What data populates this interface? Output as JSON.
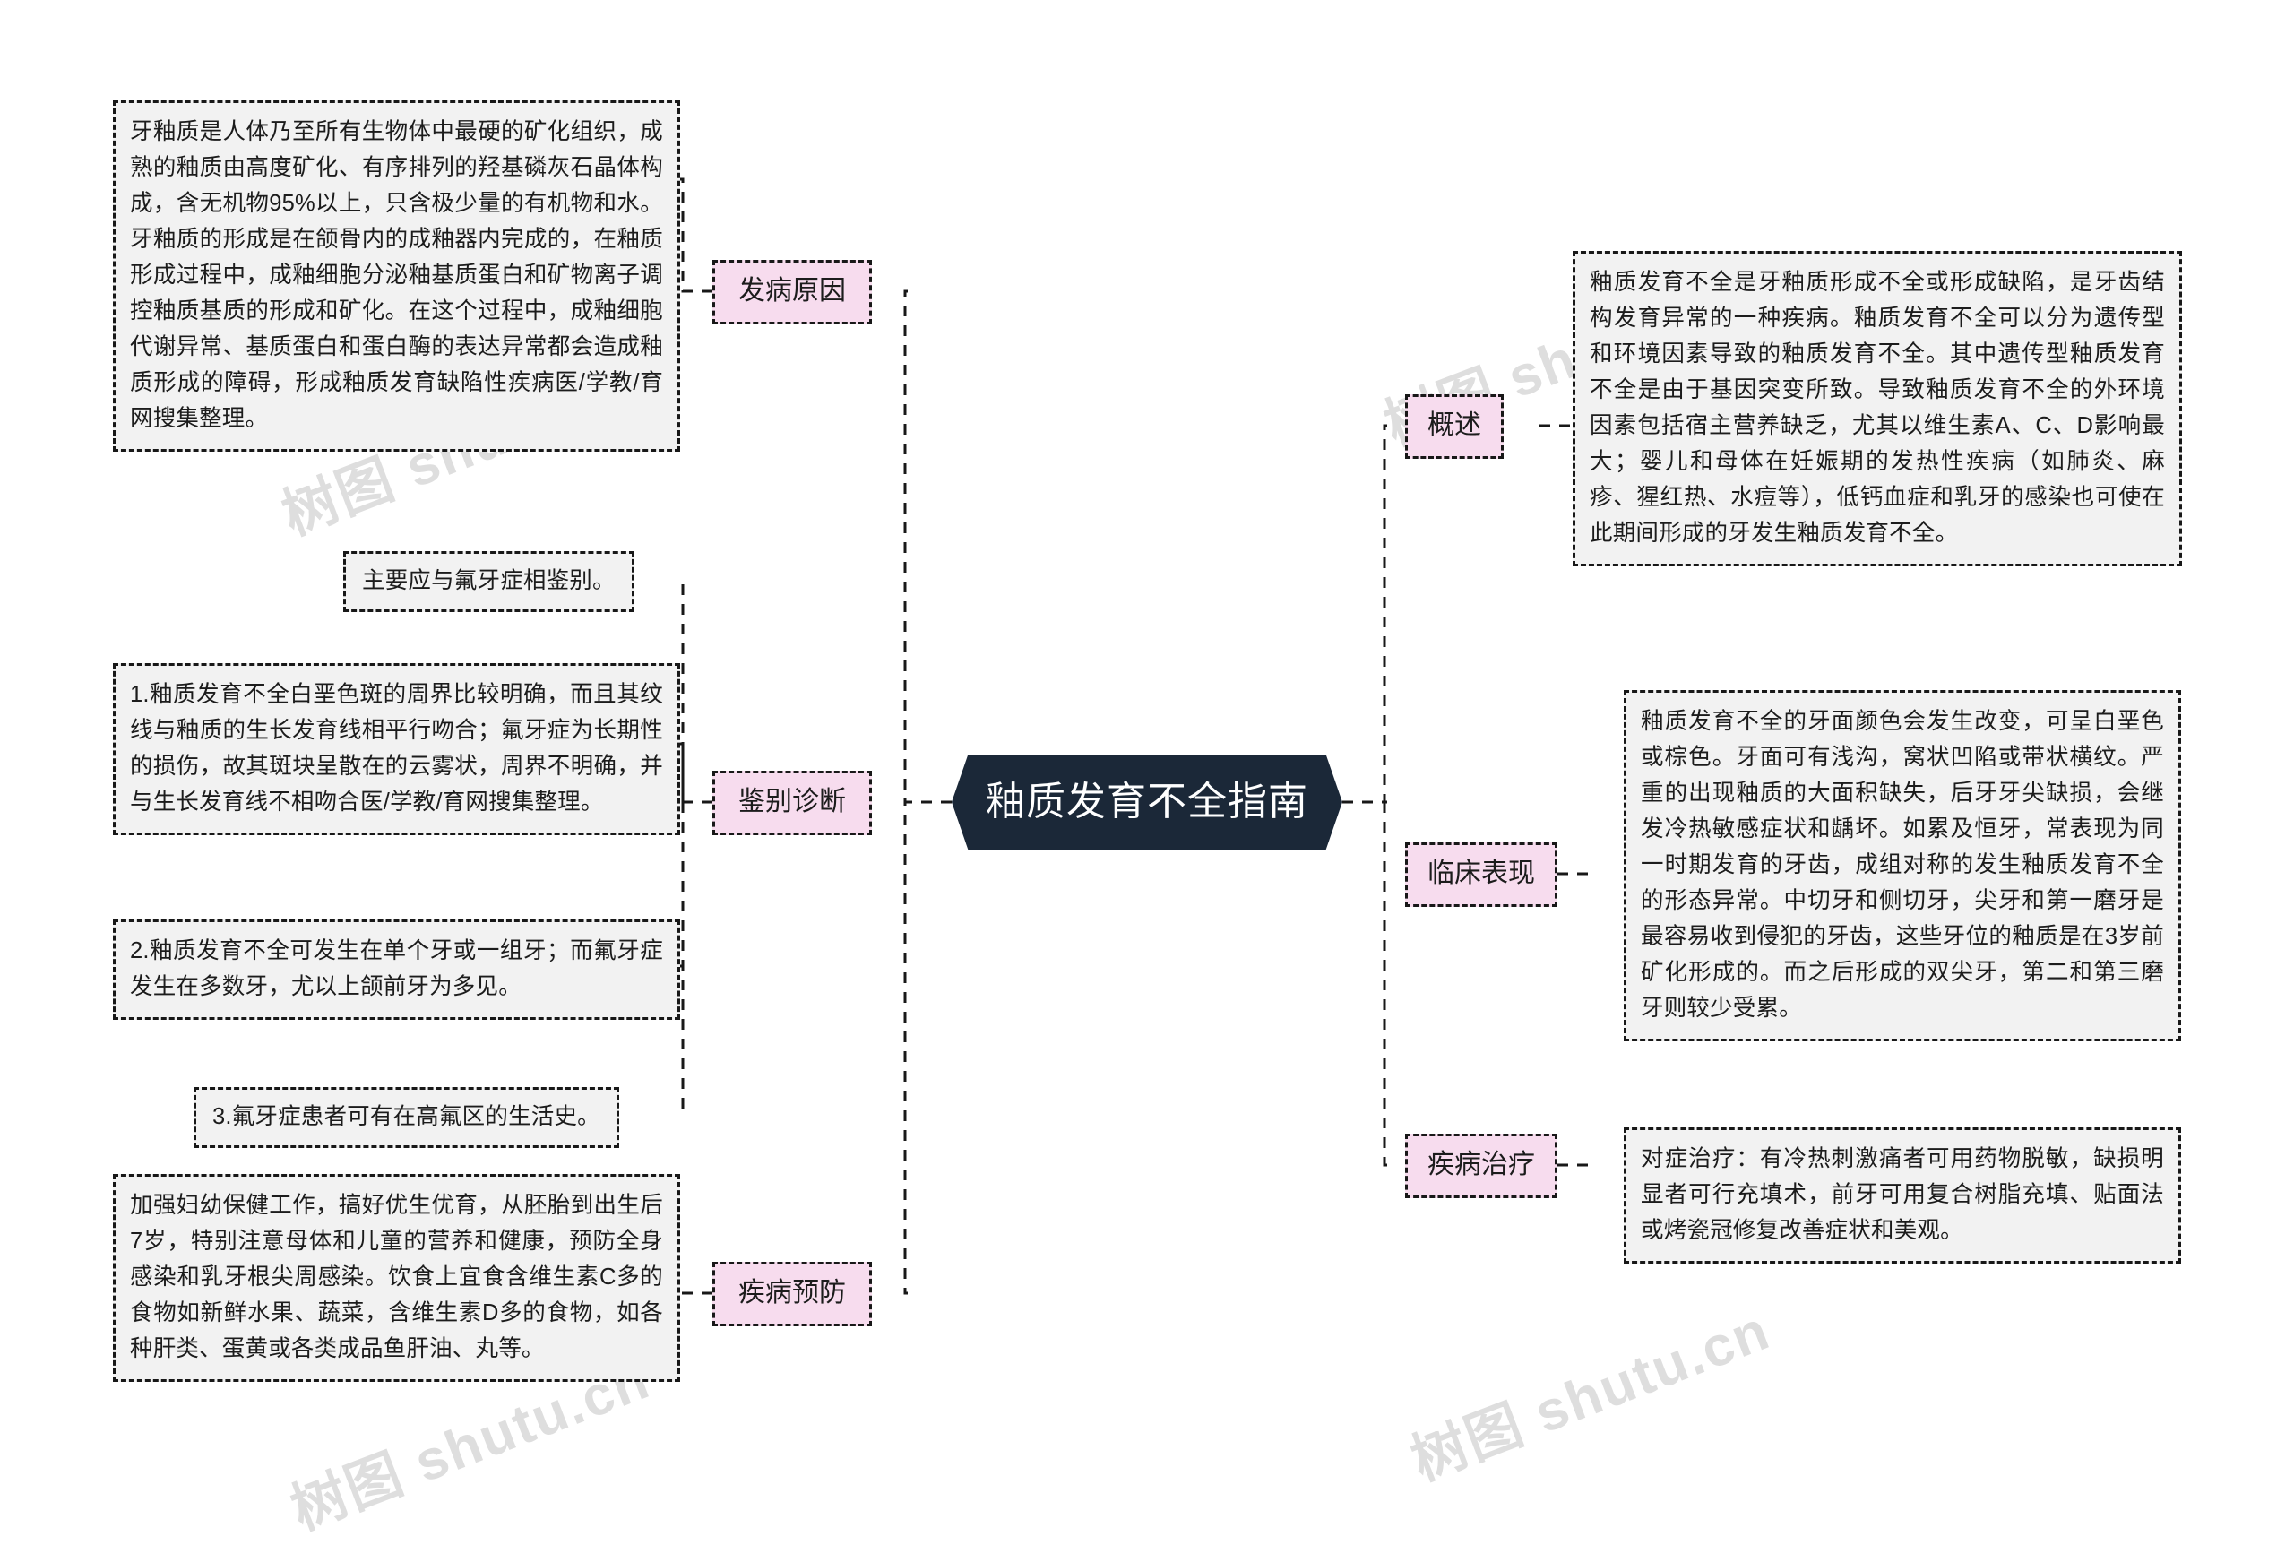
{
  "meta": {
    "watermark": "树图 shutu.cn",
    "accent_pink": "#f7dcee",
    "leaf_fill": "#f2f2f2",
    "border_color": "#181818",
    "root_fill": "#1b2838",
    "root_text_color": "#ffffff"
  },
  "root": {
    "label": "釉质发育不全指南"
  },
  "branches": {
    "left": [
      {
        "label": "发病原因",
        "leaves": [
          "牙釉质是人体乃至所有生物体中最硬的矿化组织，成熟的釉质由高度矿化、有序排列的羟基磷灰石晶体构成，含无机物95%以上，只含极少量的有机物和水。牙釉质的形成是在颌骨内的成釉器内完成的，在釉质形成过程中，成釉细胞分泌釉基质蛋白和矿物离子调控釉质基质的形成和矿化。在这个过程中，成釉细胞代谢异常、基质蛋白和蛋白酶的表达异常都会造成釉质形成的障碍，形成釉质发育缺陷性疾病医/学教/育网搜集整理。"
        ]
      },
      {
        "label": "鉴别诊断",
        "leaves": [
          "主要应与氟牙症相鉴别。",
          "1.釉质发育不全白垩色斑的周界比较明确，而且其纹线与釉质的生长发育线相平行吻合；氟牙症为长期性的损伤，故其斑块呈散在的云雾状，周界不明确，并与生长发育线不相吻合医/学教/育网搜集整理。",
          "2.釉质发育不全可发生在单个牙或一组牙；而氟牙症发生在多数牙，尤以上颌前牙为多见。",
          "3.氟牙症患者可有在高氟区的生活史。"
        ]
      },
      {
        "label": "疾病预防",
        "leaves": [
          "加强妇幼保健工作，搞好优生优育，从胚胎到出生后7岁，特别注意母体和儿童的营养和健康，预防全身感染和乳牙根尖周感染。饮食上宜食含维生素C多的食物如新鲜水果、蔬菜，含维生素D多的食物，如各种肝类、蛋黄或各类成品鱼肝油、丸等。"
        ]
      }
    ],
    "right": [
      {
        "label": "概述",
        "leaves": [
          "釉质发育不全是牙釉质形成不全或形成缺陷，是牙齿结构发育异常的一种疾病。釉质发育不全可以分为遗传型和环境因素导致的釉质发育不全。其中遗传型釉质发育不全是由于基因突变所致。导致釉质发育不全的外环境因素包括宿主营养缺乏，尤其以维生素A、C、D影响最大；婴儿和母体在妊娠期的发热性疾病（如肺炎、麻疹、猩红热、水痘等），低钙血症和乳牙的感染也可使在此期间形成的牙发生釉质发育不全。"
        ]
      },
      {
        "label": "临床表现",
        "leaves": [
          "釉质发育不全的牙面颜色会发生改变，可呈白垩色或棕色。牙面可有浅沟，窝状凹陷或带状横纹。严重的出现釉质的大面积缺失，后牙牙尖缺损，会继发冷热敏感症状和龋坏。如累及恒牙，常表现为同一时期发育的牙齿，成组对称的发生釉质发育不全的形态异常。中切牙和侧切牙，尖牙和第一磨牙是最容易收到侵犯的牙齿，这些牙位的釉质是在3岁前矿化形成的。而之后形成的双尖牙，第二和第三磨牙则较少受累。"
        ]
      },
      {
        "label": "疾病治疗",
        "leaves": [
          "对症治疗：有冷热刺激痛者可用药物脱敏，缺损明显者可行充填术，前牙可用复合树脂充填、贴面法或烤瓷冠修复改善症状和美观。"
        ]
      }
    ]
  }
}
